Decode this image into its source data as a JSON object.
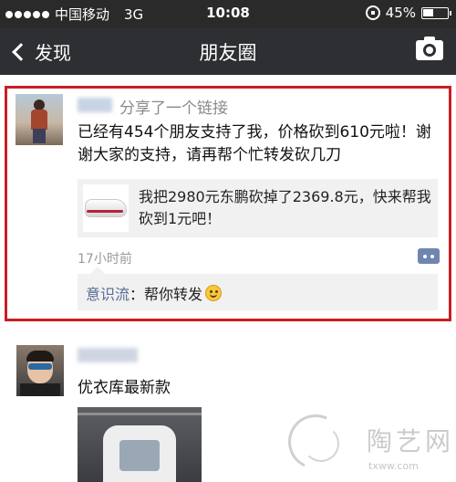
{
  "status_bar": {
    "carrier": "中国移动",
    "network": "3G",
    "time": "10:08",
    "battery": "45%",
    "battery_level": 0.45
  },
  "nav": {
    "back_label": "发现",
    "title": "朋友圈"
  },
  "posts": [
    {
      "action": "分享了一个链接",
      "body": "已经有454个朋友支持了我，价格砍到610元啦！谢谢大家的支持，请再帮个忙转发砍几刀",
      "link": {
        "title": "我把2980元东鹏砍掉了2369.8元，快来帮我砍到1元吧！"
      },
      "time_ago": "17小时前",
      "comments": [
        {
          "author": "意识流",
          "separator": "：",
          "text": "帮你转发"
        }
      ]
    },
    {
      "body": "优衣库最新款"
    }
  ],
  "watermark": {
    "name": "陶艺网",
    "url": "txww.com"
  },
  "colors": {
    "highlight_border": "#c81e24",
    "link_blue": "#576b95",
    "nav_bg": "#2e2f33"
  }
}
